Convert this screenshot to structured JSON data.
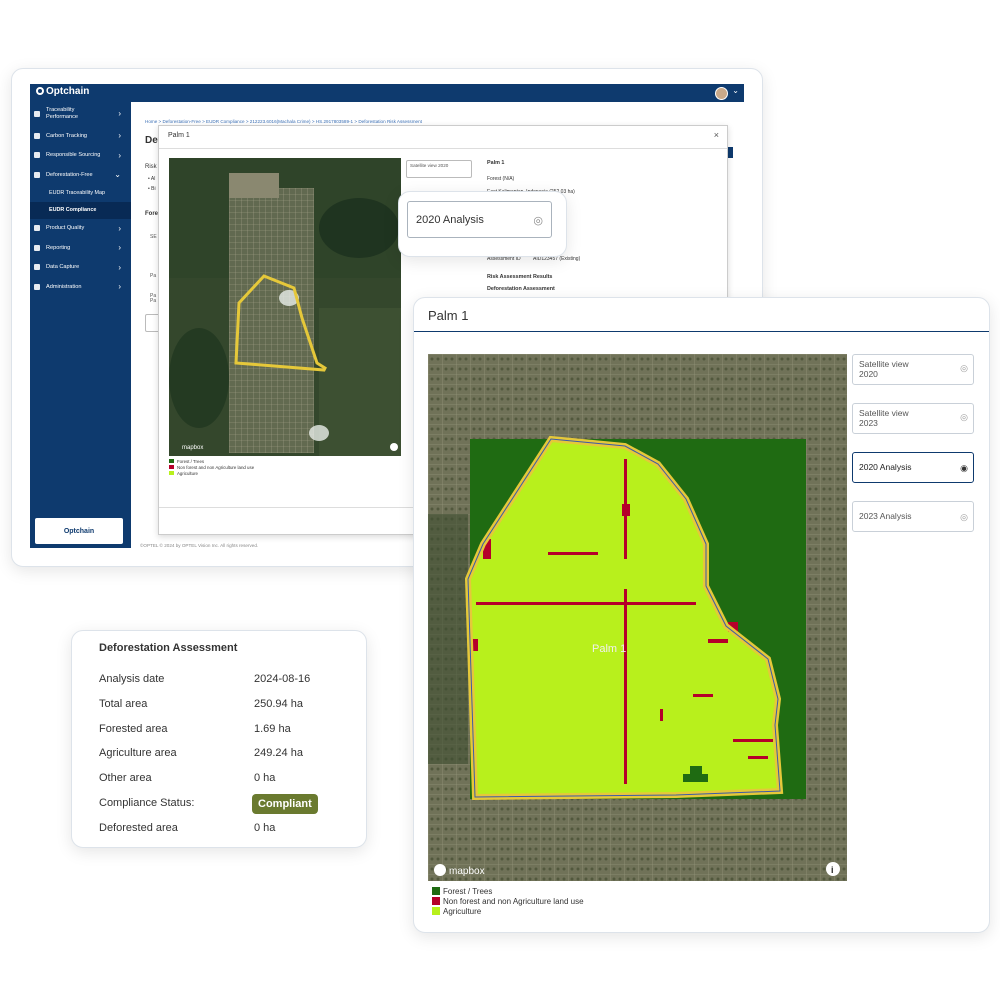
{
  "app": {
    "brand": "Optchain",
    "sidebar": {
      "items": [
        {
          "label": "Traceability Performance"
        },
        {
          "label": "Carbon Tracking"
        },
        {
          "label": "Responsible Sourcing"
        },
        {
          "label": "Deforestation-Free"
        },
        {
          "label": "Product Quality"
        },
        {
          "label": "Reporting"
        },
        {
          "label": "Data Capture"
        },
        {
          "label": "Administration"
        }
      ],
      "subitems": [
        {
          "label": "EUDR Traceability Map"
        },
        {
          "label": "EUDR Compliance"
        }
      ],
      "footer_logo": "Optchain"
    },
    "breadcrumb": "Home  >  Deforestation-Free  >  EUDR Compliance  >  212223.6016(Machala Crime)  >  HS.2917803589-1  >  Deforestation Risk Assessment",
    "page_title_fragment": "Defo",
    "risk_fragment": "Risk",
    "bullets": [
      "• Al",
      "• Bi"
    ],
    "forest_fragment": "Fores",
    "row_fragments": [
      "SE",
      "Pa",
      "Pa",
      "Pa"
    ],
    "footer": "©OPTEL © 2024 by OPTEL Vision Inc. All rights reserved.",
    "modal": {
      "title": "Palm 1",
      "close": "×",
      "satellite_btn": "Satellite view 2020",
      "info": {
        "name": "Palm 1",
        "forest": "Forest (N/A)",
        "location": "East Kalimantan, Indonesia (252.03 ha)",
        "frag1": "%",
        "frag2": "ns",
        "frag3": "IA",
        "assessment_label": "Assessment ID",
        "assessment_value": "AID123457 (Existing)",
        "risk_results": "Risk Assessment Results",
        "deforestation_assessment": "Deforestation Assessment"
      },
      "mapbox": "mapbox",
      "legend": [
        "Forest / Trees",
        "Non forest and non Agriculture land use",
        "Agriculture"
      ]
    }
  },
  "callout": {
    "label": "2020 Analysis",
    "icon": "eye-off-icon"
  },
  "deforestation": {
    "title": "Deforestation Assessment",
    "rows": [
      {
        "label": "Analysis date",
        "value": "2024-08-16"
      },
      {
        "label": "Total area",
        "value": "250.94 ha"
      },
      {
        "label": "Forested area",
        "value": "1.69 ha"
      },
      {
        "label": "Agriculture area",
        "value": "249.24 ha"
      },
      {
        "label": "Other area",
        "value": "0 ha"
      },
      {
        "label": "Compliance Status:",
        "value": "Compliant"
      },
      {
        "label": "Deforested area",
        "value": "0 ha"
      }
    ]
  },
  "palm": {
    "title": "Palm 1",
    "map_label": "Palm 1",
    "mapbox": "mapbox",
    "layers": [
      {
        "label": "Satellite view 2020",
        "visible": false
      },
      {
        "label": "Satellite view 2023",
        "visible": false
      },
      {
        "label": "2020 Analysis",
        "visible": true
      },
      {
        "label": "2023 Analysis",
        "visible": false
      }
    ],
    "legend": [
      {
        "label": "Forest / Trees",
        "color": "#1f6b12"
      },
      {
        "label": "Non forest and non Agriculture land use",
        "color": "#b5002a"
      },
      {
        "label": "Agriculture",
        "color": "#b8f01c"
      }
    ]
  },
  "colors": {
    "navy": "#0e3a6e",
    "badge": "#6a7a2f",
    "boundary": "#e5c83a"
  }
}
